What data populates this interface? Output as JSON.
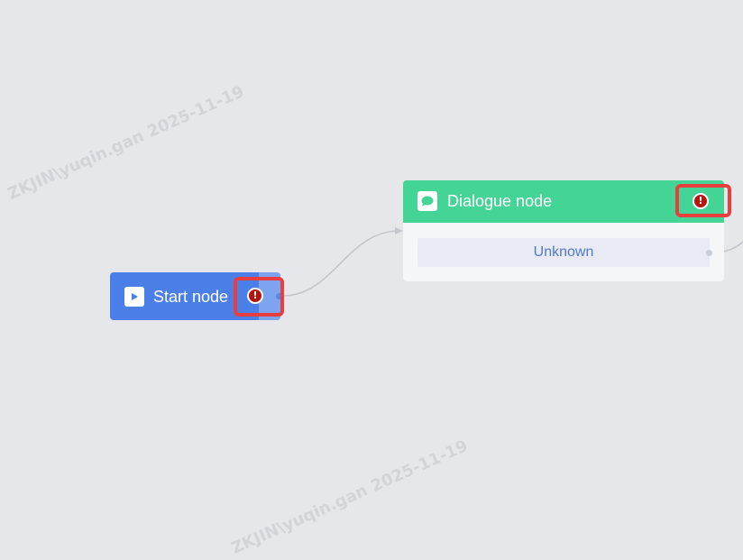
{
  "watermark": {
    "text": "ZKJIN\\yuqin.gan  2025-11-19"
  },
  "start_node": {
    "label": "Start node",
    "icon": "play-icon",
    "color": "#4a7fe8",
    "warning_icon": "exclamation-icon",
    "warning_symbol": "!"
  },
  "dialogue_node": {
    "label": "Dialogue node",
    "icon": "chat-bubble-icon",
    "color": "#44d495",
    "warning_icon": "exclamation-icon",
    "warning_symbol": "!",
    "branch_label": "Unknown"
  },
  "colors": {
    "canvas": "#e6e7eb",
    "warning": "#b3150f",
    "highlight": "#ea3d3d"
  }
}
